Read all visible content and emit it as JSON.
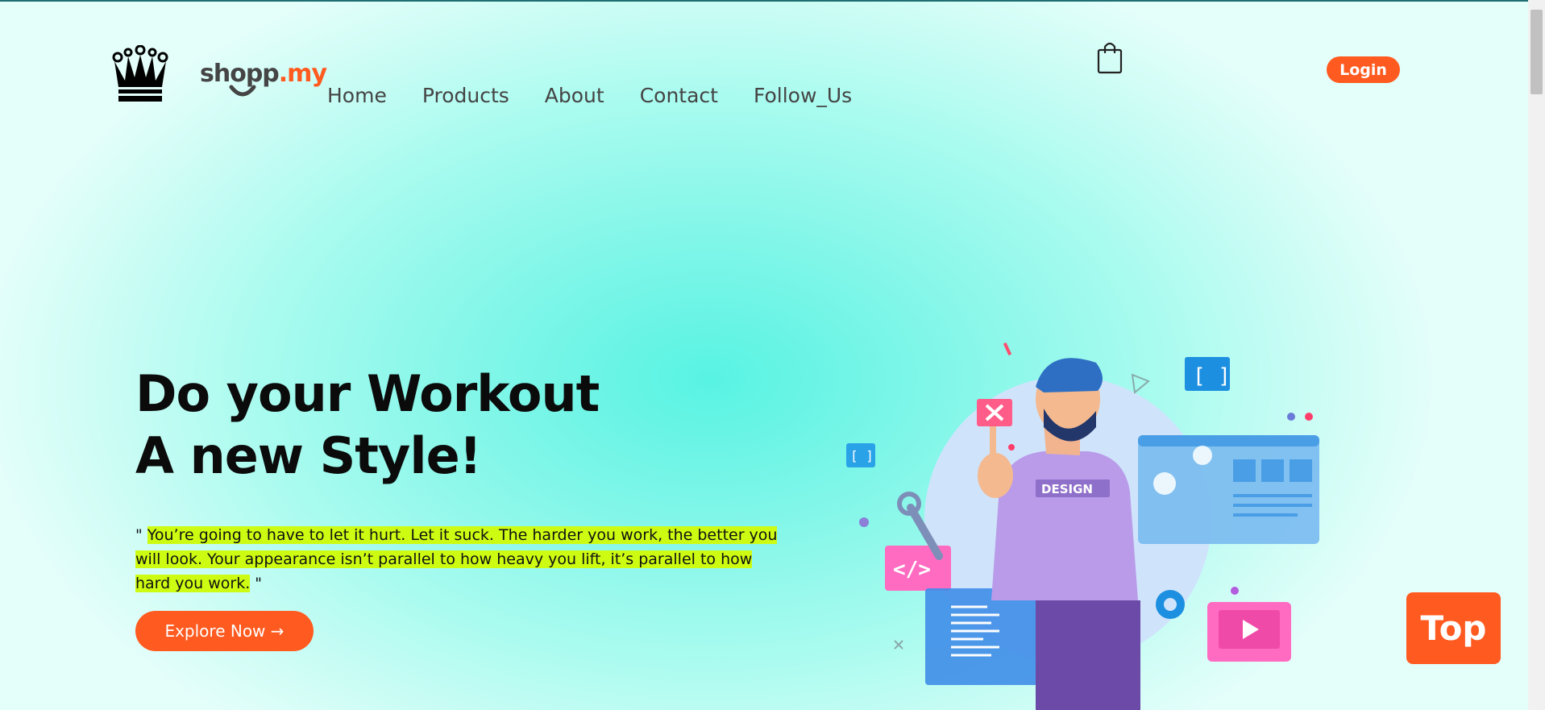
{
  "header": {
    "brand": {
      "part1": "shopp",
      "part2": ".my"
    },
    "nav": [
      "Home",
      "Products",
      "About",
      "Contact",
      "Follow_Us"
    ],
    "login_label": "Login"
  },
  "hero": {
    "title_line1": "Do your Workout",
    "title_line2": "A new Style!",
    "quote_open": "\" ",
    "quote_text": "You’re going to have to let it hurt. Let it suck. The harder you work, the better you will look. Your appearance isn’t parallel to how heavy you lift, it’s parallel to how hard you work.",
    "quote_close": " \"",
    "explore_label": "Explore Now →",
    "illustration_badge": "DESIGN"
  },
  "top_button_label": "Top",
  "colors": {
    "accent": "#ff5a1f",
    "highlight": "#cdfc12",
    "background": "#7ff6e8"
  },
  "icons": [
    "crown-logo-icon",
    "shopping-bag-icon"
  ]
}
